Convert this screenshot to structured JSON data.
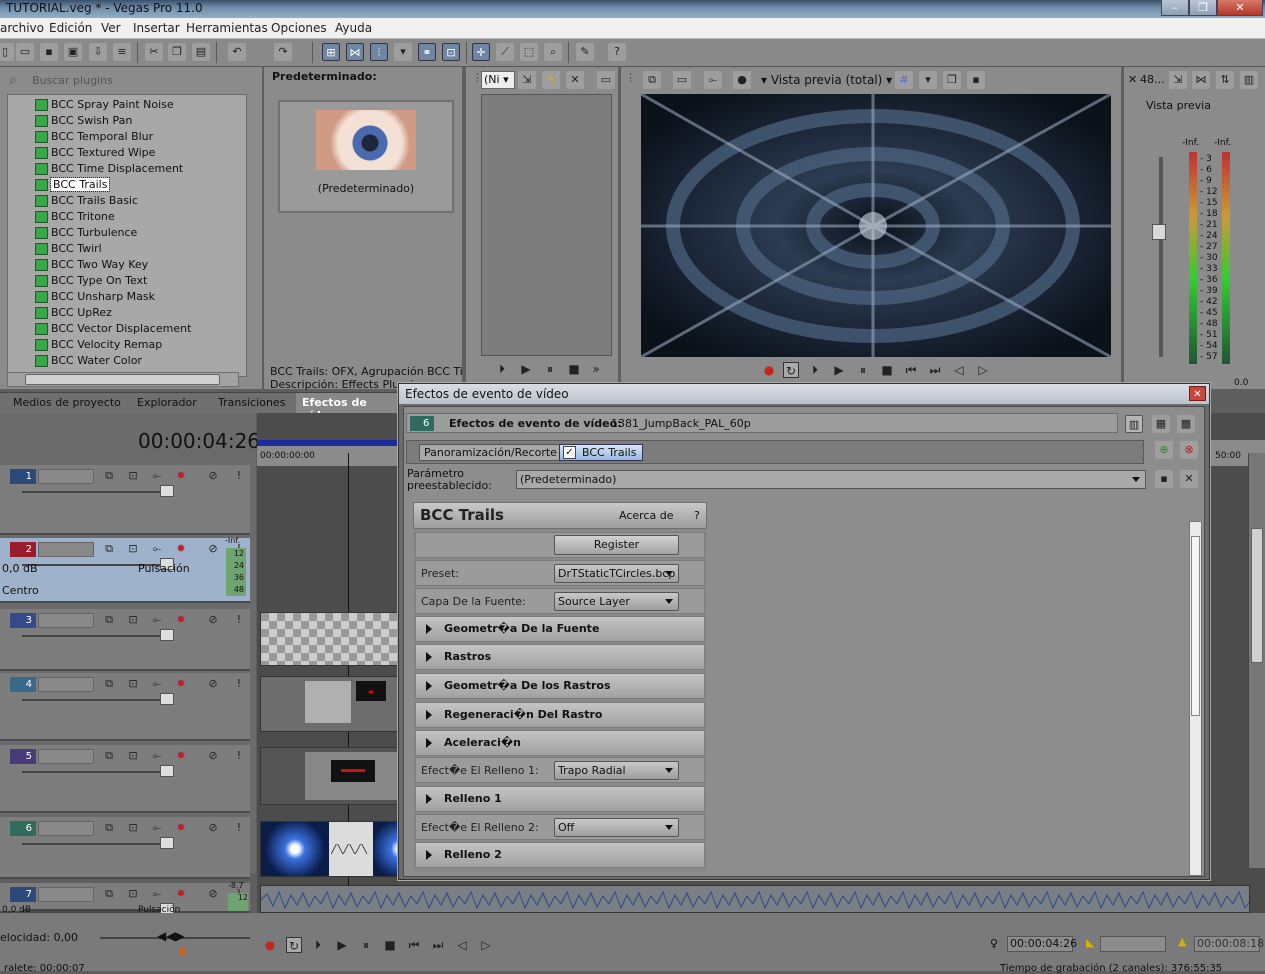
{
  "window": {
    "title": "TUTORIAL.veg * - Vegas Pro 11.0",
    "minimize": "–",
    "restore": "❐",
    "close": "✕"
  },
  "menu": [
    "archivo",
    "Edición",
    "Ver",
    "Insertar",
    "Herramientas",
    "Opciones",
    "Ayuda"
  ],
  "plugins": {
    "search_placeholder": "Buscar plugins",
    "items": [
      "BCC Spray Paint Noise",
      "BCC Swish Pan",
      "BCC Temporal Blur",
      "BCC Textured Wipe",
      "BCC Time Displacement",
      "BCC Trails",
      "BCC Trails Basic",
      "BCC Tritone",
      "BCC Turbulence",
      "BCC Twirl",
      "BCC Two Way Key",
      "BCC Type On Text",
      "BCC Unsharp Mask",
      "BCC UpRez",
      "BCC Vector Displacement",
      "BCC Velocity Remap",
      "BCC Water Color"
    ],
    "selected_index": 5
  },
  "preset_panel": {
    "header": "Predeterminado:",
    "thumb_label": "(Predeterminado)",
    "desc_line1": "BCC Trails: OFX, Agrupación BCC Time",
    "desc_line2": "Descripción: Effects Plug-i"
  },
  "trimmer": {
    "zoom_value": "(Ni"
  },
  "preview": {
    "mode": "Vista previa (total)"
  },
  "meter": {
    "top_value": "48...",
    "label": "Vista previa",
    "inf_left": "-Inf.",
    "inf_right": "-Inf.",
    "scale": [
      "3",
      "6",
      "9",
      "12",
      "15",
      "18",
      "21",
      "24",
      "27",
      "30",
      "33",
      "36",
      "39",
      "42",
      "45",
      "48",
      "51",
      "54",
      "57"
    ],
    "bottom": "0.0"
  },
  "tabs": [
    "Medios de proyecto",
    "Explorador",
    "Transiciones",
    "Efectos de vídeo"
  ],
  "timeline": {
    "timecode": "00:00:04:26",
    "ruler_start": "00:00:00:00",
    "ruler_end": "50:00",
    "track2": {
      "level": "0,0 dB",
      "pan": "Centro",
      "mode": "Pulsación",
      "inf": "-Inf.",
      "meter": [
        "12",
        "24",
        "36",
        "48"
      ]
    },
    "track7": {
      "level": "-8,7",
      "meter": "12",
      "level2": "0,0 dB",
      "mode": "Pulsación"
    },
    "tracks": [
      "1",
      "2",
      "3",
      "4",
      "5",
      "6",
      "7"
    ],
    "rate": "elocidad: 0,00",
    "status_left": "ralete: 00:00:07",
    "cursor_time": "00:00:04:26",
    "end_time": "00:00:08:18",
    "record_time": "Tiempo de grabación (2 canales): 376:55:35"
  },
  "dialog": {
    "title": "Efectos de evento de vídeo",
    "header_label": "Efectos de evento de vídeo:",
    "header_value": "1381_JumpBack_PAL_60p",
    "badge": "6",
    "chain": [
      "Panoramización/Recorte",
      "BCC Trails"
    ],
    "preset_label_1": "Parámetro",
    "preset_label_2": "preestablecido:",
    "preset_value": "(Predeterminado)",
    "plugin_name": "BCC Trails",
    "about": "Acerca de",
    "help": "?",
    "register": "Register",
    "rows": [
      {
        "kind": "param",
        "label": "Preset:",
        "value": "DrTStaticTCircles.bcp"
      },
      {
        "kind": "param",
        "label": "Capa De la Fuente:",
        "value": "Source Layer"
      },
      {
        "kind": "group",
        "label": "Geometr�a De la Fuente"
      },
      {
        "kind": "group",
        "label": "Rastros"
      },
      {
        "kind": "group",
        "label": "Geometr�a De los Rastros"
      },
      {
        "kind": "group",
        "label": "Regeneraci�n Del Rastro"
      },
      {
        "kind": "group",
        "label": "Aceleraci�n"
      },
      {
        "kind": "param",
        "label": "Efect�e El Relleno 1:",
        "value": "Trapo Radial"
      },
      {
        "kind": "group",
        "label": "Relleno 1"
      },
      {
        "kind": "param",
        "label": "Efect�e El Relleno 2:",
        "value": "Off"
      },
      {
        "kind": "group",
        "label": "Relleno 2"
      }
    ]
  }
}
